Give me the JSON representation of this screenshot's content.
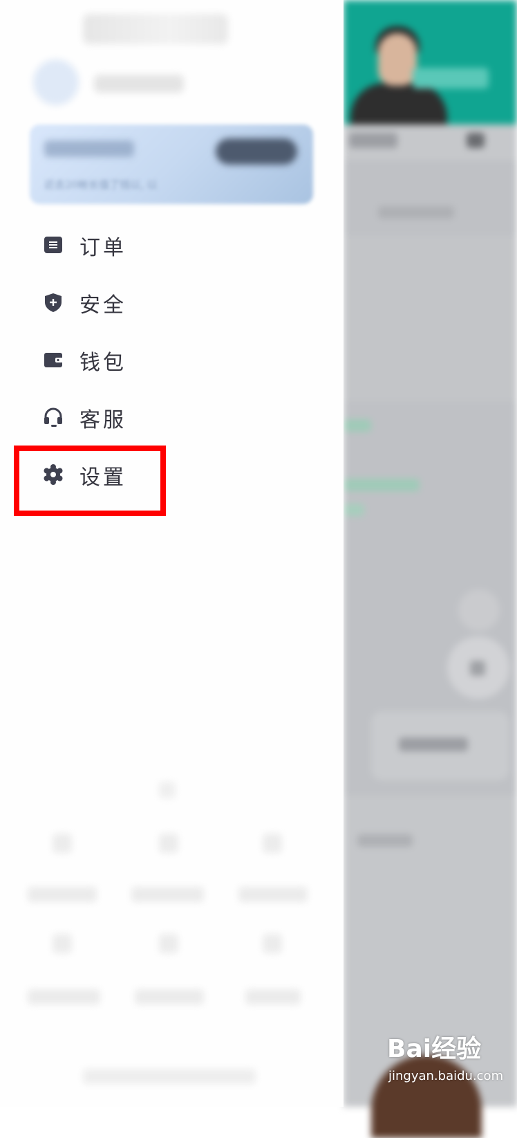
{
  "drawer": {
    "vip_card": {
      "description": "近去20帐长值了钱以, 以"
    },
    "menu": [
      {
        "name": "orders",
        "label": "订单",
        "icon": "order-list-icon"
      },
      {
        "name": "security",
        "label": "安全",
        "icon": "shield-icon"
      },
      {
        "name": "wallet",
        "label": "钱包",
        "icon": "wallet-icon"
      },
      {
        "name": "customer-service",
        "label": "客服",
        "icon": "headset-icon"
      },
      {
        "name": "settings",
        "label": "设置",
        "icon": "gear-icon"
      }
    ],
    "highlight_color": "#ff0000",
    "menu_text_color": "#35353f"
  },
  "background_page": {
    "header_color": "#10a591"
  },
  "watermark": {
    "brand": "Bai经验",
    "url": "jingyan.baidu.com"
  }
}
